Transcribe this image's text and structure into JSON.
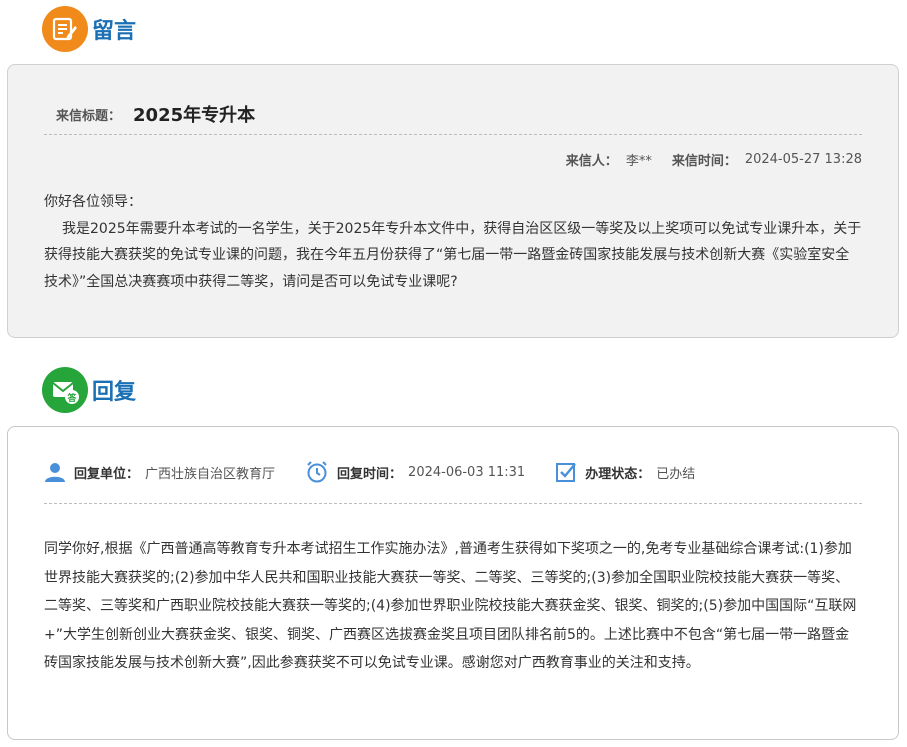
{
  "message_section": {
    "title": "留言",
    "icon": "message-edit-icon",
    "accent_color": "#f08a1a"
  },
  "message": {
    "subject_label": "来信标题：",
    "subject": "2025年专升本",
    "sender_label": "来信人：",
    "sender": "李**",
    "time_label": "来信时间：",
    "time": "2024-05-27 13:28",
    "greeting": "你好各位领导：",
    "content": "我是2025年需要升本考试的一名学生，关于2025年专升本文件中，获得自治区区级一等奖及以上奖项可以免试专业课升本，关于获得技能大赛获奖的免试专业课的问题，我在今年五月份获得了“第七届一带一路暨金砖国家技能发展与技术创新大赛《实验室安全技术》”全国总决赛赛项中获得二等奖，请问是否可以免试专业课呢?"
  },
  "reply_section": {
    "title": "回复",
    "icon": "reply-mail-icon",
    "accent_color": "#26a53b"
  },
  "reply": {
    "unit_label": "回复单位：",
    "unit": "广西壮族自治区教育厅",
    "time_label": "回复时间：",
    "time": "2024-06-03 11:31",
    "status_label": "办理状态：",
    "status": "已办结",
    "content": "同学你好,根据《广西普通高等教育专升本考试招生工作实施办法》,普通考生获得如下奖项之一的,免考专业基础综合课考试:(1)参加世界技能大赛获奖的;(2)参加中华人民共和国职业技能大赛获一等奖、二等奖、三等奖的;(3)参加全国职业院校技能大赛获一等奖、二等奖、三等奖和广西职业院校技能大赛获一等奖的;(4)参加世界职业院校技能大赛获金奖、银奖、铜奖的;(5)参加中国国际“互联网+”大学生创新创业大赛获金奖、银奖、铜奖、广西赛区选拔赛金奖且项目团队排名前5的。上述比赛中不包含“第七届一带一路暨金砖国家技能发展与技术创新大赛”,因此参赛获奖不可以免试专业课。感谢您对广西教育事业的关注和支持。"
  },
  "colors": {
    "heading_blue": "#1a6fb5",
    "meta_icon_blue": "#4a90d9"
  }
}
